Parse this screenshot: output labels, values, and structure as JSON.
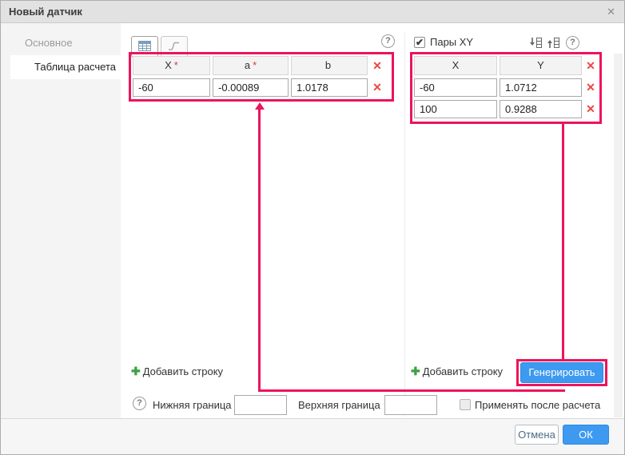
{
  "dialog": {
    "title": "Новый датчик"
  },
  "icons": {
    "close": "✕",
    "delete": "✕",
    "add": "✚",
    "help": "?",
    "check": "✔"
  },
  "sidebar": {
    "items": [
      {
        "label": "Основное"
      },
      {
        "label": "Таблица расчета"
      }
    ]
  },
  "calc_panel": {
    "table": {
      "headers": [
        {
          "label": "X",
          "required": "*"
        },
        {
          "label": "a",
          "required": "*"
        },
        {
          "label": "b",
          "required": ""
        }
      ],
      "rows": [
        {
          "x": "-60",
          "a": "-0.00089",
          "b": "1.0178"
        }
      ]
    },
    "add_row": "Добавить строку"
  },
  "pairs_panel": {
    "checkbox_label": "Пары XY",
    "table": {
      "headers": [
        {
          "label": "X"
        },
        {
          "label": "Y"
        }
      ],
      "rows": [
        {
          "x": "-60",
          "y": "1.0712"
        },
        {
          "x": "100",
          "y": "0.9288"
        }
      ]
    },
    "add_row": "Добавить строку",
    "generate": "Генерировать"
  },
  "bounds": {
    "lower_label": "Нижняя граница",
    "lower_value": "",
    "upper_label": "Верхняя граница",
    "upper_value": "",
    "apply_label": "Применять после расчета"
  },
  "footer": {
    "cancel": "Отмена",
    "ok": "ОК"
  },
  "colors": {
    "annotation": "#ed145b",
    "accent_blue": "#3d9af0",
    "delete_red": "#ee4540",
    "add_green": "#3fa142"
  }
}
